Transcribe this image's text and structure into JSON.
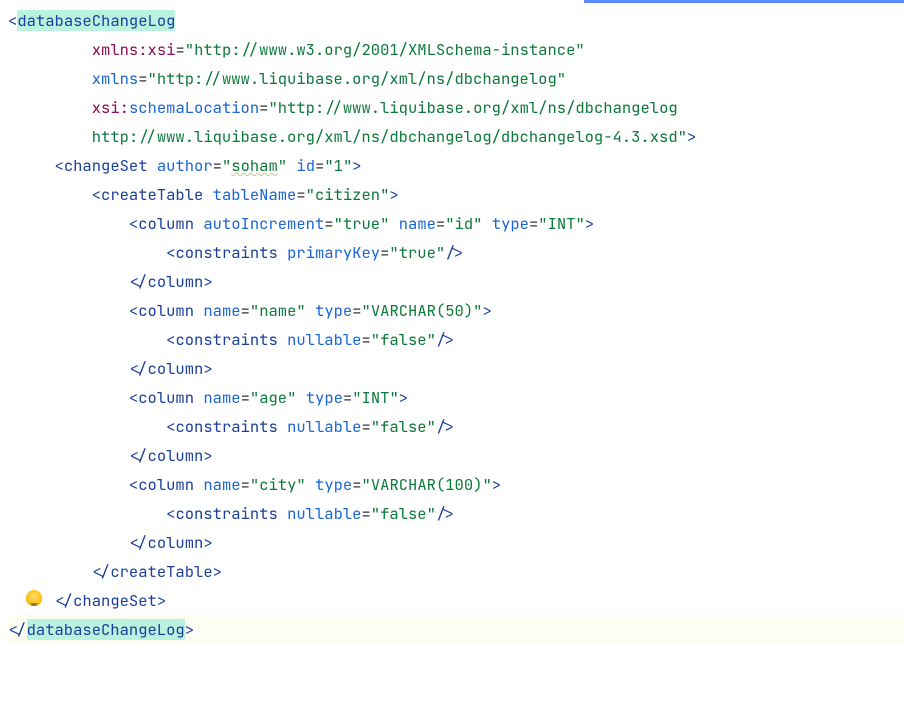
{
  "code": {
    "rootTag": "databaseChangeLog",
    "xmlnsXsiPrefix": "xmlns",
    "xmlnsXsiLocal": "xsi",
    "xmlnsXsiVal": "http://www.w3.org/2001/XMLSchema-instance",
    "xmlnsAttr": "xmlns",
    "xmlnsVal": "http://www.liquibase.org/xml/ns/dbchangelog",
    "xsiPrefix": "xsi",
    "xsiLocal": "schemaLocation",
    "xsiVal1": "http://www.liquibase.org/xml/ns/dbchangelog",
    "xsiVal2": "http://www.liquibase.org/xml/ns/dbchangelog/dbchangelog-4.3.xsd",
    "changeSetTag": "changeSet",
    "authorAttr": "author",
    "authorVal": "soham",
    "idAttr": "id",
    "idVal": "1",
    "createTableTag": "createTable",
    "tableNameAttr": "tableName",
    "tableNameVal": "citizen",
    "columnTag": "column",
    "constraintsTag": "constraints",
    "autoIncAttr": "autoIncrement",
    "trueVal": "true",
    "falseVal": "false",
    "nameAttr": "name",
    "typeAttr": "type",
    "pkAttr": "primaryKey",
    "nullableAttr": "nullable",
    "col1Name": "id",
    "col1Type": "INT",
    "col2Name": "name",
    "col2Type": "VARCHAR(50)",
    "col3Name": "age",
    "col3Type": "INT",
    "col4Name": "city",
    "col4Type": "VARCHAR(100)"
  }
}
